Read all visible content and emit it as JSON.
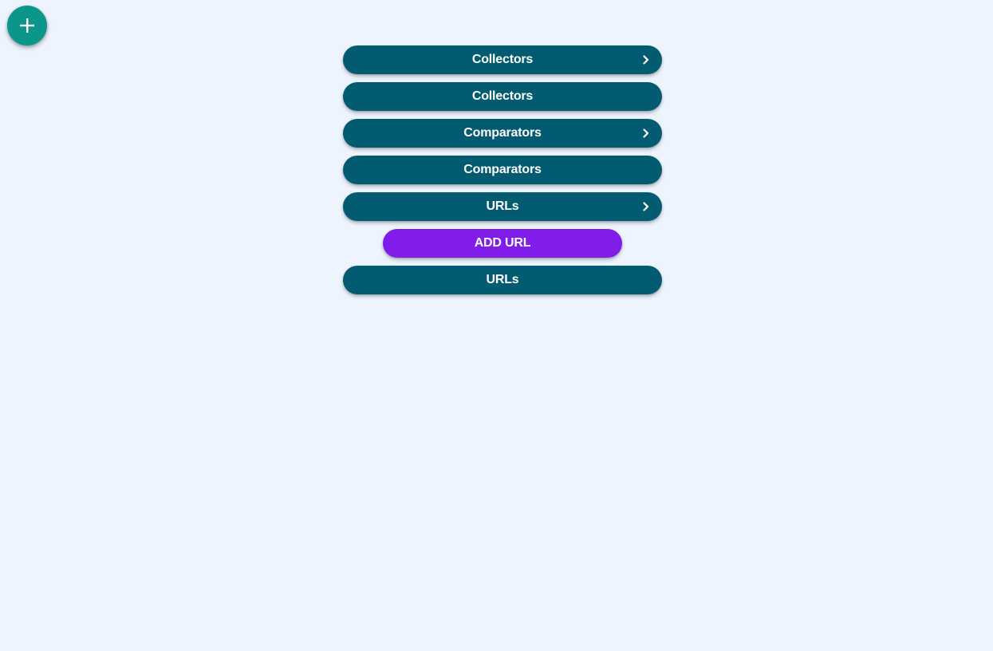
{
  "fab": {
    "icon": "plus-icon",
    "color": "#0a968a"
  },
  "colors": {
    "background": "#edf4fe",
    "pill": "#035b72",
    "add_button": "#801de9",
    "text": "#ffffff"
  },
  "items": [
    {
      "label": "Collectors",
      "chevron": "chevron-right-icon"
    },
    {
      "label": "Collectors"
    },
    {
      "label": "Comparators",
      "chevron": "chevron-right-icon"
    },
    {
      "label": "Comparators"
    },
    {
      "label": "URLs",
      "chevron": "chevron-right-icon"
    }
  ],
  "add_url": {
    "label": "ADD URL"
  },
  "last_item": {
    "label": "URLs"
  }
}
